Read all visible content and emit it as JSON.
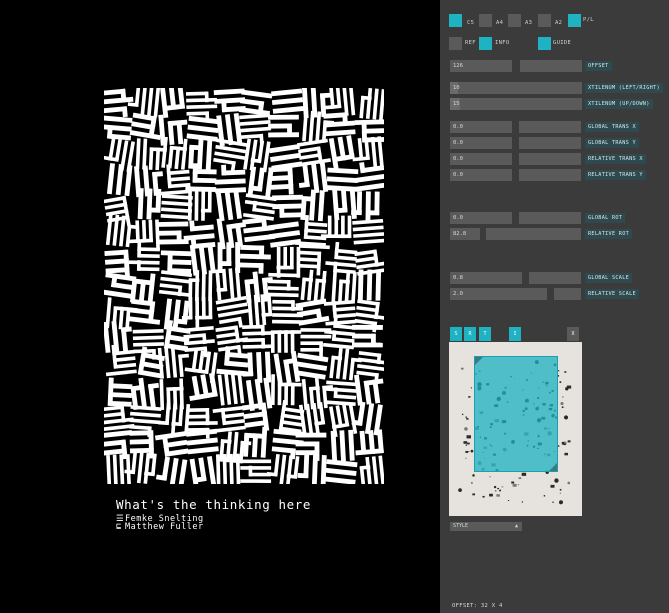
{
  "poster": {
    "title": "What's the thinking here",
    "authors": [
      {
        "glyph": "☰",
        "name": "Femke Snelting"
      },
      {
        "glyph": "⊑",
        "name": "Matthew Fuller"
      }
    ]
  },
  "panel": {
    "formats": [
      {
        "label": "C5",
        "checked": true
      },
      {
        "label": "A4",
        "checked": false
      },
      {
        "label": "A3",
        "checked": false
      },
      {
        "label": "A2",
        "checked": false
      },
      {
        "label": "P/L",
        "checked": true
      }
    ],
    "options": [
      {
        "label": "REF",
        "checked": false
      },
      {
        "label": "INFO",
        "checked": true
      },
      {
        "label": "GUIDE"
      },
      {
        "label": "",
        "checked": true
      }
    ],
    "offset": {
      "value": "126",
      "label": "OFFSET"
    },
    "columns_lr": {
      "value": "10",
      "label": "XTILENUM (LEFT/RIGHT)"
    },
    "rows_ud": {
      "value": "15",
      "label": "XTILENUM (UP/DOWN)"
    },
    "global_trans_x": {
      "value": "0.0",
      "label": "GLOBAL TRANS X"
    },
    "global_trans_y": {
      "value": "0.0",
      "label": "GLOBAL TRANS Y"
    },
    "relative_trans_x": {
      "value": "0.0",
      "label": "RELATIVE TRANS X"
    },
    "relative_trans_y": {
      "value": "0.0",
      "label": "RELATIVE TRANS Y"
    },
    "global_rot": {
      "value": "0.0",
      "label": "GLOBAL ROT"
    },
    "relative_rot": {
      "value": "82.8",
      "label": "RELATIVE ROT"
    },
    "global_scale": {
      "value": "0.8",
      "label": "GLOBAL SCALE"
    },
    "relative_scale": {
      "value": "2.0",
      "label": "RELATIVE SCALE"
    },
    "image_tabs": [
      "S",
      "R",
      "T",
      "I"
    ],
    "close_label": "X",
    "style_dropdown": {
      "value": "STYLE",
      "arrow": "▲"
    },
    "status": "OFFSET: 32 X 4",
    "accent": "#1eb2c2"
  }
}
